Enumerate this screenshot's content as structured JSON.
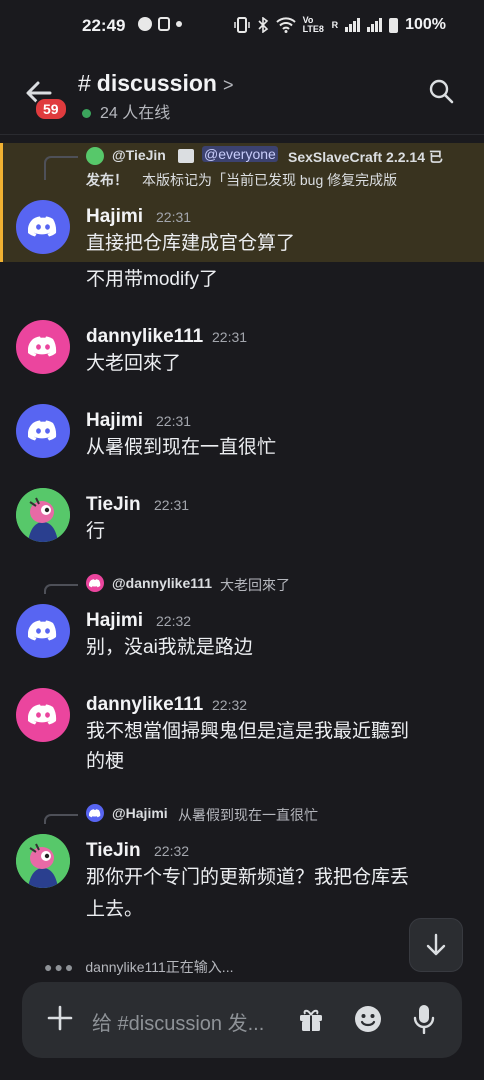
{
  "status_bar": {
    "time": "22:49",
    "battery": "100%",
    "network": "Vo LTE8",
    "roaming": "R"
  },
  "header": {
    "badge": "59",
    "channel": "discussion",
    "online": "24 人在线"
  },
  "messages": [
    {
      "reply": {
        "author": "@TieJin",
        "mention": "@everyone",
        "snippet": "SexSlaveCraft 2.2.14 已",
        "snippet2": "发布！",
        "snippet3": "本版标记为「当前已发现 bug 修复完成版"
      },
      "author": "Hajimi",
      "time": "22:31",
      "lines": [
        "直接把仓库建成官仓算了",
        "不用带modify了"
      ]
    },
    {
      "author": "dannylike111",
      "time": "22:31",
      "lines": [
        "大老回來了"
      ]
    },
    {
      "author": "Hajimi",
      "time": "22:31",
      "lines": [
        "从暑假到现在一直很忙"
      ]
    },
    {
      "author": "TieJin",
      "time": "22:31",
      "lines": [
        "行"
      ]
    },
    {
      "reply": {
        "author": "@dannylike111",
        "snippet": "大老回來了"
      },
      "author": "Hajimi",
      "time": "22:32",
      "lines": [
        "别，没ai我就是路边"
      ]
    },
    {
      "author": "dannylike111",
      "time": "22:32",
      "lines": [
        "我不想當個掃興鬼但是這是我最近聽到",
        "的梗"
      ]
    },
    {
      "reply": {
        "author": "@Hajimi",
        "snippet": "从暑假到现在一直很忙"
      },
      "author": "TieJin",
      "time": "22:32",
      "lines": [
        "那你开个专门的更新频道？我把仓库丢",
        "上去。"
      ]
    }
  ],
  "typing": "dannylike111正在输入...",
  "composer": {
    "placeholder": "给 #discussion 发..."
  },
  "colors": {
    "blurple": "#5865f2",
    "pink": "#eb459e",
    "green": "#57c86a",
    "mention_highlight": "#39331f",
    "mention_bar": "#f0b132"
  }
}
